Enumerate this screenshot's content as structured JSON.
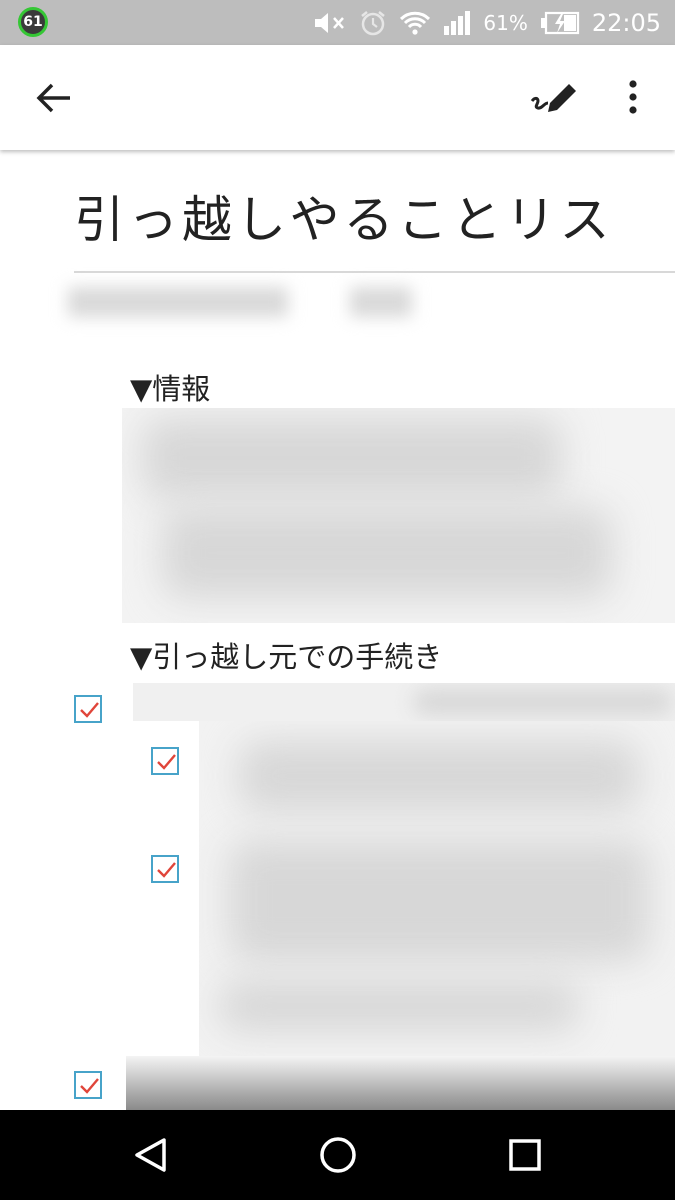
{
  "status_bar": {
    "notification_badge": "61",
    "battery_percent": "61%",
    "time": "22:05"
  },
  "app_bar": {
    "back_icon": "arrow-back-icon",
    "edit_icon": "pen-edit-icon",
    "more_icon": "more-vert-icon"
  },
  "document": {
    "title": "引っ越しやることリス",
    "sections": [
      {
        "heading": "▼情報"
      },
      {
        "heading": "▼引っ越し元での手続き"
      }
    ],
    "checkboxes_checked": [
      true,
      true,
      true,
      true
    ]
  },
  "nav_bar": {
    "icons": [
      "back-triangle-icon",
      "home-circle-icon",
      "recents-square-icon"
    ]
  },
  "colors": {
    "status_bar": "#bdbdbd",
    "checkbox_border": "#47a3c9",
    "check_mark": "#e0453a",
    "nav_bar": "#000000"
  }
}
